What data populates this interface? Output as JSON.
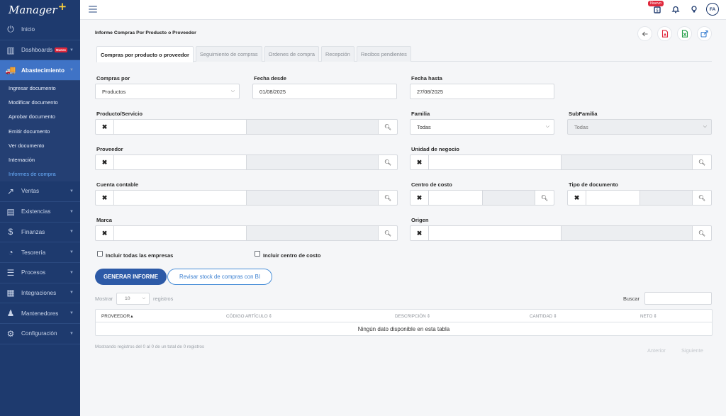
{
  "sidebar": {
    "logo_text": "Manager",
    "logo_plus": "+",
    "items": [
      {
        "label": "Inicio",
        "icon": "power-icon",
        "glyph": "⏻"
      },
      {
        "label": "Dashboards",
        "icon": "dashboard-icon",
        "glyph": "▥",
        "badge": "Nuevo"
      },
      {
        "label": "Abastecimiento",
        "icon": "truck-icon",
        "glyph": "🚚"
      },
      {
        "label": "Ventas",
        "icon": "trend-icon",
        "glyph": "↗"
      },
      {
        "label": "Existencias",
        "icon": "clipboard-icon",
        "glyph": "▤"
      },
      {
        "label": "Finanzas",
        "icon": "dollar-icon",
        "glyph": "$"
      },
      {
        "label": "Tesorería",
        "icon": "piggybank-icon",
        "glyph": "◔"
      },
      {
        "label": "Procesos",
        "icon": "sliders-icon",
        "glyph": "☰"
      },
      {
        "label": "Integraciones",
        "icon": "grid-icon",
        "glyph": "▦"
      },
      {
        "label": "Mantenedores",
        "icon": "users-icon",
        "glyph": "♟"
      },
      {
        "label": "Configuración",
        "icon": "gear-icon",
        "glyph": "⚙"
      }
    ],
    "subitems": [
      "Ingresar documento",
      "Modificar documento",
      "Aprobar documento",
      "Emitir documento",
      "Ver documento",
      "Internación",
      "Informes de compra"
    ]
  },
  "topbar": {
    "new_tag": "Nuevo",
    "avatar": "FA"
  },
  "page": {
    "title": "Informe Compras Por Producto o Proveedor"
  },
  "tabs": [
    "Compras por producto o proveedor",
    "Seguimiento de compras",
    "Ordenes de compra",
    "Recepción",
    "Recibos pendientes"
  ],
  "form": {
    "compras_por_label": "Compras por",
    "compras_por_value": "Productos",
    "fecha_desde_label": "Fecha desde",
    "fecha_desde_value": "01/08/2025",
    "fecha_hasta_label": "Fecha hasta",
    "fecha_hasta_value": "27/08/2025",
    "producto_label": "Producto/Servicio",
    "familia_label": "Familia",
    "familia_value": "Todas",
    "subfamilia_label": "SubFamilia",
    "subfamilia_value": "Todas",
    "proveedor_label": "Proveedor",
    "unidad_label": "Unidad de negocio",
    "cuenta_label": "Cuenta contable",
    "centro_label": "Centro de costo",
    "tipo_doc_label": "Tipo de documento",
    "marca_label": "Marca",
    "origen_label": "Origen",
    "chk_empresas": "Incluir todas las empresas",
    "chk_centro": "Incluir centro de costo"
  },
  "buttons": {
    "generar": "GENERAR INFORME",
    "revisar": "Revisar stock de compras con BI"
  },
  "table": {
    "mostrar": "Mostrar",
    "length_value": "10",
    "registros": "registros",
    "buscar": "Buscar",
    "columns": [
      "PROVEEDOR",
      "CÓDIGO ARTÍCULO",
      "DESCRIPCIÓN",
      "CANTIDAD",
      "NETO"
    ],
    "sort_marks": [
      "▴",
      "⇕",
      "⇕",
      "⇕",
      "⇕"
    ],
    "empty": "Ningún dato disponible en esta tabla",
    "info": "Mostrando registros del 0 al 0 de un total de 0 registros",
    "prev": "Anterior",
    "next": "Siguiente"
  },
  "colors": {
    "sidebar_bg": "#1e3a6e",
    "active_item": "#3f73c6",
    "primary_button": "#2d5aa7",
    "badge": "#e0283c"
  }
}
